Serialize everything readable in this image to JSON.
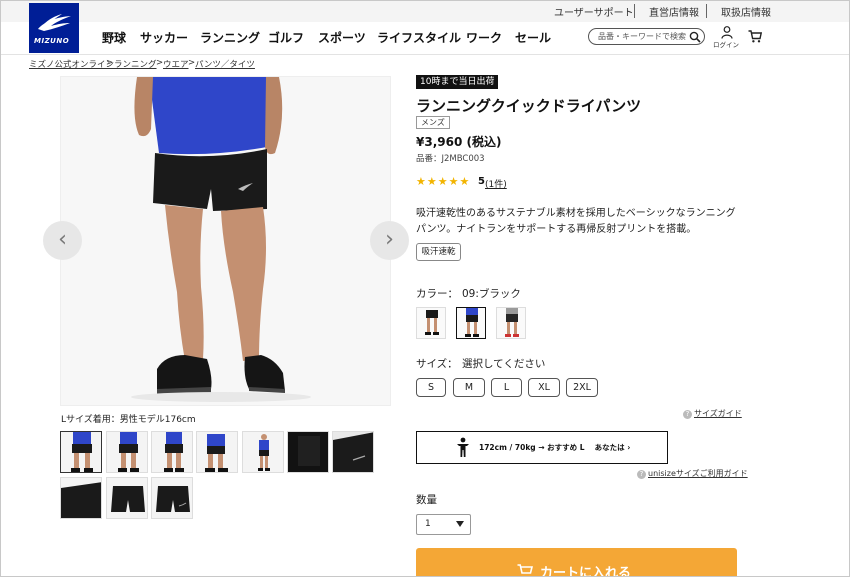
{
  "utility_bar": {
    "support": "ユーザーサポート",
    "direct_stores": "直営店情報",
    "dealers": "取扱店情報"
  },
  "logo_text": "MIZUNO",
  "nav": {
    "items": [
      "野球",
      "サッカー",
      "ランニング",
      "ゴルフ",
      "スポーツ",
      "ライフスタイル",
      "ワーク",
      "セール"
    ]
  },
  "search": {
    "placeholder": "品番・キーワードで検索"
  },
  "login_label": "ログイン",
  "breadcrumb": [
    "ミズノ公式オンライン",
    "ランニング",
    "ウエア",
    "パンツ／タイツ"
  ],
  "gallery": {
    "caption": "Lサイズ着用：男性モデル176cm",
    "prev_icon": "‹",
    "next_icon": "›"
  },
  "product": {
    "shipping_badge": "10時まで当日出荷",
    "title": "ランニングクイックドライパンツ",
    "gender": "メンズ",
    "price": "¥3,960 (税込)",
    "code": "品番：J2MBC003",
    "stars": "★★★★★",
    "rating": "5",
    "reviews": "(1件)",
    "description": "吸汗速乾性のあるサステナブル素材を採用したベーシックなランニングパンツ。ナイトランをサポートする再帰反射プリントを搭載。",
    "feature_tag": "吸汗速乾",
    "color_label": "カラー：",
    "color_value": "09:ブラック",
    "size_label": "サイズ：",
    "size_value": "選択してください",
    "sizes": [
      "S",
      "M",
      "L",
      "XL",
      "2XL"
    ],
    "size_guide": "サイズガイド",
    "unisize_text": "172cm / 70kg → おすすめ L　 あなたは ›",
    "unisize_guide": "unisizeサイズご利用ガイド",
    "qty_label": "数量",
    "qty_value": "1",
    "cart_label": "カートに入れる"
  },
  "colors": {
    "brand": "#001e96",
    "shirt": "#2f46c9",
    "cart": "#f4a736",
    "star": "#f2b400"
  }
}
